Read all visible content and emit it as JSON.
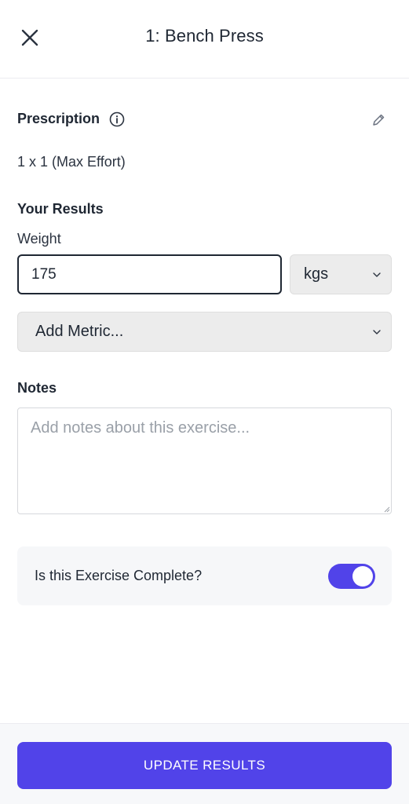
{
  "header": {
    "title": "1: Bench Press",
    "close_icon": "close-icon"
  },
  "prescription": {
    "label": "Prescription",
    "info_icon": "info-icon",
    "edit_icon": "pencil-icon",
    "value": "1 x 1 (Max Effort)"
  },
  "results": {
    "label": "Your Results",
    "weight_label": "Weight",
    "weight_value": "175",
    "unit_selected": "kgs",
    "add_metric_placeholder": "Add Metric..."
  },
  "notes": {
    "label": "Notes",
    "placeholder": "Add notes about this exercise...",
    "value": ""
  },
  "completion": {
    "question": "Is this Exercise Complete?",
    "toggle_on": true
  },
  "footer": {
    "button_label": "UPDATE RESULTS"
  },
  "colors": {
    "accent": "#5143e9",
    "text": "#1f2733",
    "field_bg": "#ececec"
  }
}
